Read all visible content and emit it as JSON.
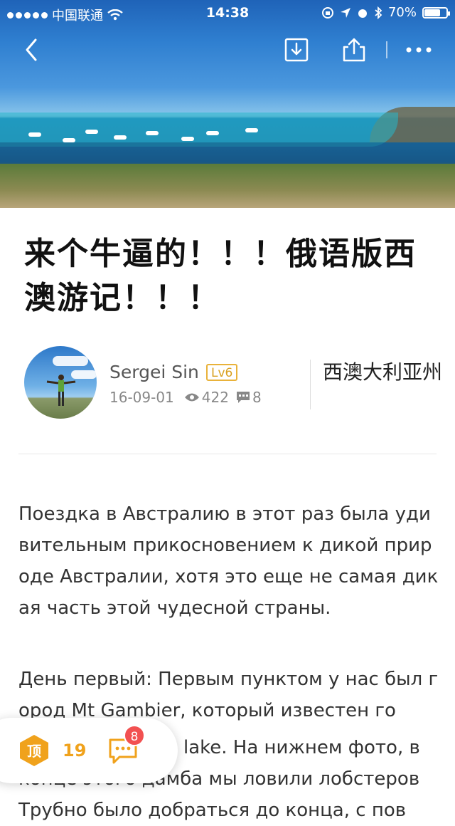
{
  "status_bar": {
    "carrier": "中国联通",
    "time": "14:38",
    "battery": "70%",
    "battery_level": 0.7
  },
  "nav": {
    "back_icon": "chevron-left-icon",
    "download_icon": "download-icon",
    "share_icon": "share-icon",
    "more_icon": "more-dots-icon"
  },
  "article": {
    "title": "来个牛逼的！！！俄语版西澳游记！！！",
    "author": {
      "name": "Sergei Sin",
      "level": "Lv6",
      "date": "16-09-01",
      "views": "422",
      "comments": "8"
    },
    "location": "西澳大利亚州",
    "paragraphs": [
      "Поездка в Австралию в этот раз была удивительным прикосновением к дикой природе Австралии, хотя это еще не самая дикая часть этой чудесной страны.",
      "День первый: Первым пунктом у нас был город Mt Gambier, который известен го",
      "lake. На нижнем фото, в",
      "конце этого дамба мы ловили лобстеров",
      "Трубно было добраться до конца, с пов"
    ]
  },
  "floating_bar": {
    "up_label": "顶",
    "up_count": "19",
    "comment_badge": "8"
  },
  "colors": {
    "accent": "#f0a21c",
    "badge": "#f25151",
    "level_border": "#e9b23a"
  }
}
